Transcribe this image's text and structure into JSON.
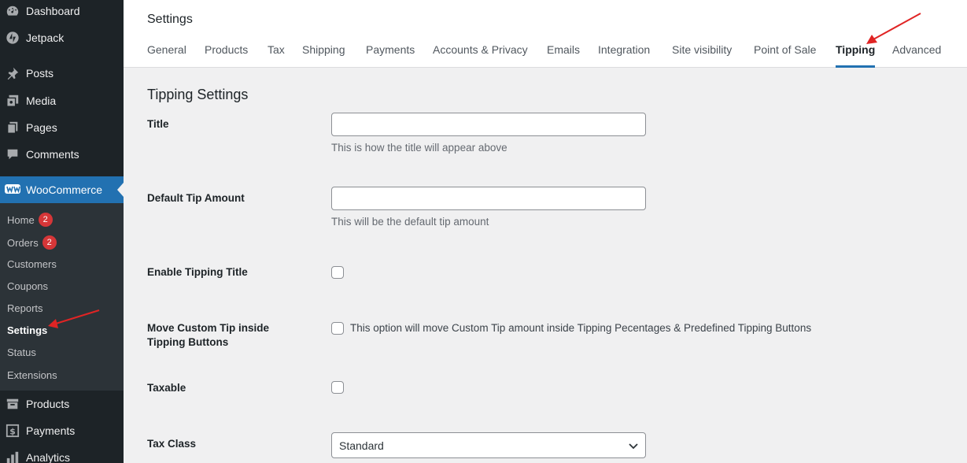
{
  "sidebar": {
    "items": [
      {
        "label": "Dashboard",
        "icon": "dashboard-icon"
      },
      {
        "label": "Jetpack",
        "icon": "jetpack-icon"
      },
      {
        "label": "Posts",
        "icon": "pin-icon"
      },
      {
        "label": "Media",
        "icon": "media-icon"
      },
      {
        "label": "Pages",
        "icon": "pages-icon"
      },
      {
        "label": "Comments",
        "icon": "comments-icon"
      },
      {
        "label": "WooCommerce",
        "icon": "woocommerce-icon"
      },
      {
        "label": "Products",
        "icon": "products-icon"
      },
      {
        "label": "Payments",
        "icon": "payments-icon"
      },
      {
        "label": "Analytics",
        "icon": "analytics-icon"
      }
    ],
    "submenu": [
      {
        "label": "Home",
        "badge": "2"
      },
      {
        "label": "Orders",
        "badge": "2"
      },
      {
        "label": "Customers"
      },
      {
        "label": "Coupons"
      },
      {
        "label": "Reports"
      },
      {
        "label": "Settings"
      },
      {
        "label": "Status"
      },
      {
        "label": "Extensions"
      }
    ]
  },
  "header": {
    "title": "Settings",
    "tabs": [
      "General",
      "Products",
      "Tax",
      "Shipping",
      "Payments",
      "Accounts & Privacy",
      "Emails",
      "Integration",
      "Site visibility",
      "Point of Sale",
      "Tipping",
      "Advanced"
    ],
    "active_tab": "Tipping"
  },
  "form": {
    "section_title": "Tipping Settings",
    "title_label": "Title",
    "title_value": "",
    "title_desc": "This is how the title will appear above",
    "default_tip_label": "Default Tip Amount",
    "default_tip_value": "",
    "default_tip_desc": "This will be the default tip amount",
    "enable_title_label": "Enable Tipping Title",
    "move_custom_label": "Move Custom Tip inside Tipping Buttons",
    "move_custom_desc": "This option will move Custom Tip amount inside Tipping Pecentages & Predefined Tipping Buttons",
    "taxable_label": "Taxable",
    "tax_class_label": "Tax Class",
    "tax_class_value": "Standard"
  },
  "colors": {
    "sidebar_bg": "#1d2327",
    "accent": "#2271b1",
    "annotation_arrow": "#e02424"
  }
}
